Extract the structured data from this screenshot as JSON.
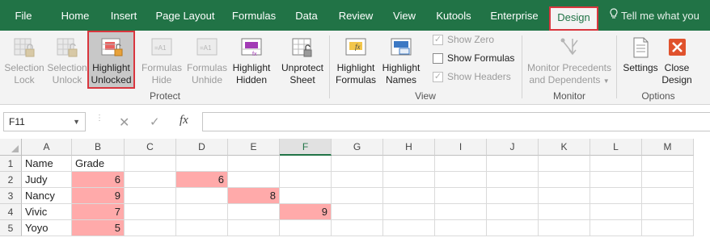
{
  "tabs": [
    "File",
    "Home",
    "Insert",
    "Page Layout",
    "Formulas",
    "Data",
    "Review",
    "View",
    "Kutools",
    "Enterprise",
    "Design"
  ],
  "tell_me": "Tell me what you wa",
  "ribbon": {
    "protect": {
      "group_label": "Protect",
      "buttons": [
        {
          "line1": "Selection",
          "line2": "Lock",
          "state": "disabled"
        },
        {
          "line1": "Selection",
          "line2": "Unlock",
          "state": "disabled"
        },
        {
          "line1": "Highlight",
          "line2": "Unlocked",
          "state": "selected"
        },
        {
          "line1": "Formulas",
          "line2": "Hide",
          "state": "disabled"
        },
        {
          "line1": "Formulas",
          "line2": "Unhide",
          "state": "disabled"
        },
        {
          "line1": "Highlight",
          "line2": "Hidden",
          "state": "normal"
        },
        {
          "line1": "Unprotect",
          "line2": "Sheet",
          "state": "normal"
        }
      ]
    },
    "view": {
      "group_label": "View",
      "buttons": [
        {
          "line1": "Highlight",
          "line2": "Formulas"
        },
        {
          "line1": "Highlight",
          "line2": "Names"
        }
      ],
      "checkboxes": [
        {
          "label": "Show Zero",
          "checked": true,
          "disabled": true
        },
        {
          "label": "Show Formulas",
          "checked": false,
          "disabled": false
        },
        {
          "label": "Show Headers",
          "checked": true,
          "disabled": true
        }
      ]
    },
    "monitor": {
      "group_label": "Monitor",
      "button": {
        "line1": "Monitor Precedents",
        "line2": "and Dependents"
      }
    },
    "options": {
      "group_label": "Options",
      "buttons": [
        {
          "line1": "Settings",
          "line2": ""
        },
        {
          "line1": "Close",
          "line2": "Design"
        }
      ]
    }
  },
  "formula_bar": {
    "name_box": "F11",
    "fx": "fx",
    "value": ""
  },
  "sheet": {
    "columns": [
      "A",
      "B",
      "C",
      "D",
      "E",
      "F",
      "G",
      "H",
      "I",
      "J",
      "K",
      "L",
      "M"
    ],
    "selected_column": "F",
    "rows": [
      {
        "num": "1",
        "cells": {
          "A": "Name",
          "B": "Grade"
        }
      },
      {
        "num": "2",
        "cells": {
          "A": "Judy",
          "B": "6",
          "D": "6"
        }
      },
      {
        "num": "3",
        "cells": {
          "A": "Nancy",
          "B": "9",
          "E": "8"
        }
      },
      {
        "num": "4",
        "cells": {
          "A": "Vivic",
          "B": "7",
          "F": "9"
        }
      },
      {
        "num": "5",
        "cells": {
          "A": "Yoyo",
          "B": "5"
        }
      }
    ],
    "highlighted_cells": [
      "B2",
      "B3",
      "B4",
      "B5",
      "D2",
      "E3",
      "F4"
    ],
    "highlight_color": "#ffaaaa",
    "accent_color": "#217346",
    "tab_highlight_border": "#d9363e"
  }
}
